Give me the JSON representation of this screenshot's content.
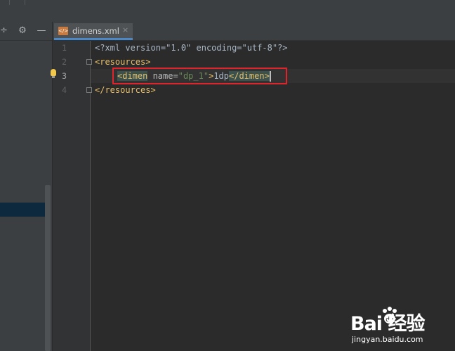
{
  "project_panel": {
    "toolbar": {
      "collapse_icon": "split-collapse-icon",
      "settings_icon": "gear-icon",
      "hide_icon": "minus-icon"
    }
  },
  "tabs": [
    {
      "label": "dimens.xml",
      "icon": "xml-file-icon",
      "close": "×",
      "active": true
    }
  ],
  "editor": {
    "line_numbers": [
      "1",
      "2",
      "3",
      "4"
    ],
    "current_line": "3",
    "lines": [
      {
        "segments": [
          {
            "cls": "text",
            "t": "<?xml version=\"1.0\" encoding=\"utf-8\"?>"
          }
        ]
      },
      {
        "segments": [
          {
            "cls": "tag",
            "t": "<resources>"
          }
        ]
      },
      {
        "segments": [
          {
            "cls": "tag tag-hl",
            "t": "<dimen"
          },
          {
            "cls": "attr",
            "t": " name="
          },
          {
            "cls": "val",
            "t": "\"dp_1\""
          },
          {
            "cls": "tag",
            "t": ">"
          },
          {
            "cls": "text",
            "t": "1dp"
          },
          {
            "cls": "tag tag-hl",
            "t": "</dimen>"
          }
        ]
      },
      {
        "segments": [
          {
            "cls": "tag",
            "t": "</resources>"
          }
        ]
      }
    ]
  },
  "watermark": {
    "main": "Bai  经验",
    "sub": "jingyan.baidu.com"
  },
  "colors": {
    "highlight_border": "#e0242b",
    "tag": "#e8bf6a",
    "value": "#6a8759",
    "editor_bg": "#2b2b2b"
  }
}
